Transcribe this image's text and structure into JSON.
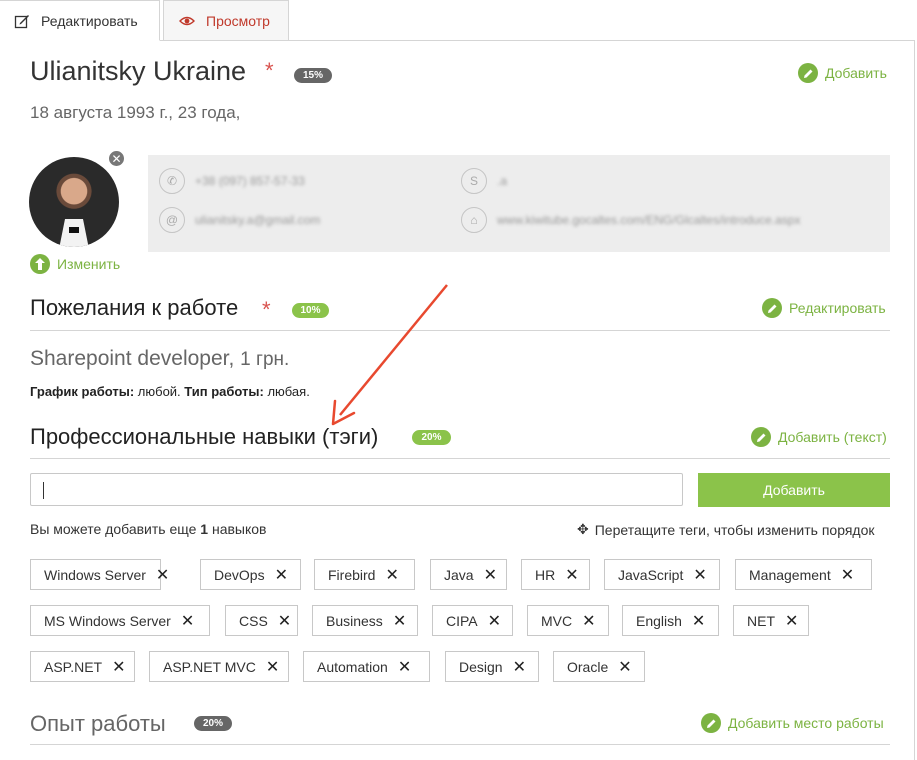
{
  "tabs": {
    "edit": "Редактировать",
    "view": "Просмотр"
  },
  "profile": {
    "name": "Ulianitsky Ukraine",
    "required": "*",
    "percent": "15%",
    "add_label": "Добавить",
    "birth": "18 августа 1993 г., 23 года,",
    "change_label": "Изменить",
    "remove": "✕"
  },
  "contacts": {
    "phone": "+38 (097) 857-57-33",
    "skype": ".a",
    "email": "ulianitsky.a@gmail.com",
    "site": "www.kiwitube.gocaltes.com/ENG/Glcaltes/introduce.aspx"
  },
  "wishes": {
    "title": "Пожелания к работе",
    "required": "*",
    "percent": "10%",
    "edit_label": "Редактировать",
    "position": "Sharepoint developer,",
    "salary": "1 грн.",
    "schedule_label": "График работы:",
    "schedule_value": "любой.",
    "type_label": "Тип работы:",
    "type_value": "любая."
  },
  "skills": {
    "title": "Профессиональные навыки (тэги)",
    "percent": "20%",
    "add_text_label": "Добавить (текст)",
    "input_value": "",
    "add_button": "Добавить",
    "hint_prefix": "Вы можете добавить еще",
    "hint_count": "1",
    "hint_suffix": "навыков",
    "drag_hint": "Перетащите теги, чтобы изменить порядок",
    "tags": [
      "Windows Server",
      "DevOps",
      "Firebird",
      "Java",
      "HR",
      "JavaScript",
      "Management",
      "MS Windows Server",
      "CSS",
      "Business",
      "CIPA",
      "MVC",
      "English",
      "NET",
      "ASP.NET",
      "ASP.NET MVC",
      "Automation",
      "Design",
      "Oracle"
    ]
  },
  "experience": {
    "title": "Опыт работы",
    "percent": "20%",
    "add_label": "Добавить место работы"
  },
  "colors": {
    "accent": "#7cb342",
    "button": "#8bc34a",
    "required": "#d9534f",
    "annotation_arrow": "#e8492f"
  }
}
